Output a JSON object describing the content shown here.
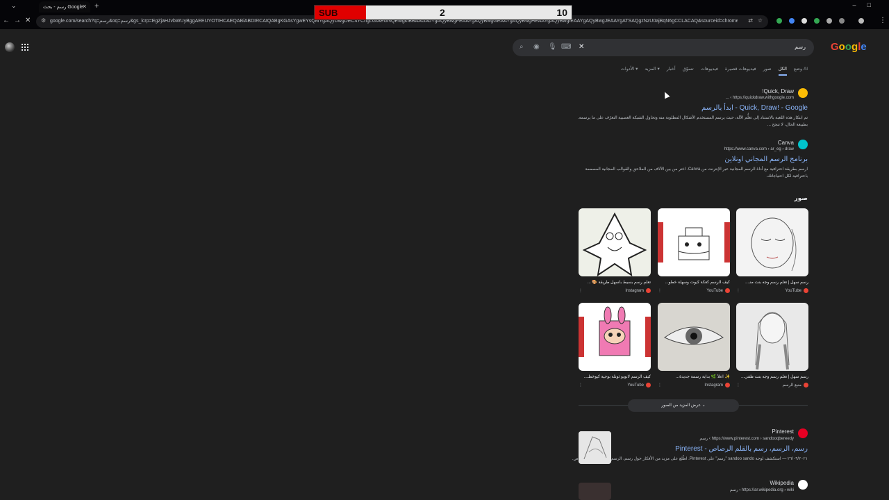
{
  "browser": {
    "tab_title": "رسم - بحث Google",
    "url": "google.com/search?q=رسم&oq=رسم&gs_lcrp=EgZjaHJvbWUyBggAEEUYOTIHCAEQABiABDIRCAIQABgKGAsYgwEYsQMYgAQyDwgDEC4YChgLGIAEGNQEMgkIBBAAGAoYgAQyBwgFEAAYgAQyBwgGEAAYgAQyBwgHEAAYgAQyBwgIEAAYgAQyBwgJEAAYgATSAQgzNzU0ajBqN6gCCLACAQ&sourceid=chrome&ie=UTF-8"
  },
  "overlay": {
    "label": "SUB",
    "current": "2",
    "goal": "10",
    "progress": 0.2,
    "fill_color": "#e00000"
  },
  "header": {
    "logo_letters": [
      "G",
      "o",
      "o",
      "g",
      "l",
      "e"
    ],
    "logo_colors": [
      "#ea4335",
      "#fbbc05",
      "#34a853",
      "#fbbc05",
      "#ea4335",
      "#4285f4"
    ],
    "search_query": "رسم"
  },
  "tabs": [
    "وضع AI",
    "الكل",
    "صور",
    "فيديوهات قصيرة",
    "فيديوهات",
    "تسوّق",
    "أخبار",
    "المزيد ▾",
    "الأدوات ▾"
  ],
  "results": [
    {
      "site": "Quick, Draw!",
      "cite": "https://quickdraw.withgoogle.com › ...",
      "title": "Quick, Draw! - Google - ابدأ بالرسم",
      "snippet": "تم ابتكار هذه اللعبة بالاستناد إلى تعلُّم الآلة، حيث يرسم المستخدم الأشكال المطلوبة منه وتحاول الشبكة العصبية التعرّف على ما يرسمه. بطبيعة الحال، لا تنجح ...",
      "favicon_color": "#fbbc05"
    },
    {
      "site": "Canva",
      "cite": "https://www.canva.com › ar_eg › draw",
      "title": "برنامج الرسم المجاني اونلاين",
      "snippet": "ارسم بطريقة احترافية مع أداة الرسم المجانية عبر الإنترنت من Canva. اختر من بين الآلاف من الملاحق والقوالب المجانية المصممة باحترافية لكل احتياجاتك.",
      "favicon_color": "#00c4cc"
    }
  ],
  "images": {
    "heading": "صور",
    "cards": [
      {
        "caption": "رسم سهل | تعلم رسم وجه بنت منـ...",
        "source": "YouTube",
        "kind": "face"
      },
      {
        "caption": "كيف الرسم كعكة كيوت وسهلة خطو...",
        "source": "YouTube",
        "kind": "cake"
      },
      {
        "caption": "تعلم رسم بسيط بأسهل طريقة 🎨 ...",
        "source": "Instagram",
        "kind": "patrick"
      },
      {
        "caption": "رسم سهل | تعلم رسم وجه بنت ظفي...",
        "source": "منبع الرسم",
        "kind": "girl"
      },
      {
        "caption": "✨ اعلاً 🌿 بداية رسمة جديدة...",
        "source": "Instagram",
        "kind": "eye"
      },
      {
        "caption": "كيف الرسم لابوبو ثونلة بوجية كيوخطـ...",
        "source": "YouTube",
        "kind": "labubu"
      }
    ],
    "more_label": "عرض المزيد من الصور"
  },
  "results2": [
    {
      "site": "Pinterest",
      "cite": "https://www.pinterest.com › sandooqbereedy › رسم",
      "title": "رسم، الرسم، رسم بالقلم الرصاص - Pinterest",
      "snippet": "٢٦/٠٩/٢٠٢١ — استكشف لوحة sandoo sando \"رسم\" على Pinterest. اطّلع على مزيد من الأفكار حول رسم، الرسم، رسم بالقلم الرصاص.",
      "favicon_color": "#e60023"
    },
    {
      "site": "Wikipedia",
      "cite": "https://ar.wikipedia.org › wiki › رسم",
      "favicon_color": "#ffffff"
    }
  ]
}
